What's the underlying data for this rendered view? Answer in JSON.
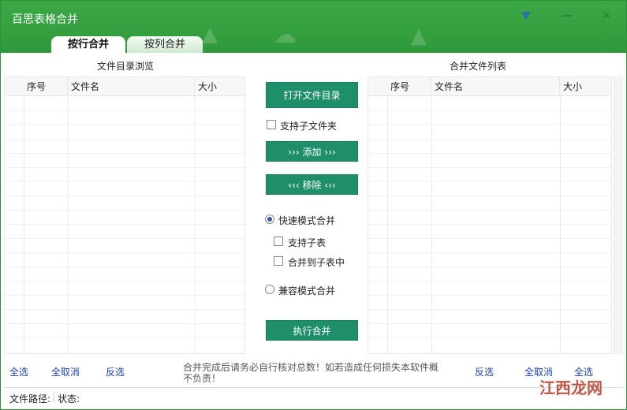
{
  "window": {
    "title": "百思表格合并"
  },
  "tabs": [
    {
      "label": "按行合并"
    },
    {
      "label": "按列合并"
    }
  ],
  "left_panel": {
    "title": "文件目录浏览",
    "columns": [
      "序号",
      "文件名",
      "大小"
    ]
  },
  "right_panel": {
    "title": "合并文件列表",
    "columns": [
      "序号",
      "文件名",
      "大小"
    ]
  },
  "center": {
    "open_dir": "打开文件目录",
    "include_sub": "支持子文件夹",
    "add": "››› 添加 ›››",
    "remove": "‹‹‹ 移除 ‹‹‹",
    "fast_mode": "快速模式合并",
    "support_sub_sheet": "支持子表",
    "merge_to_sub_sheet": "合并到子表中",
    "compat_mode": "兼容模式合并",
    "run": "执行合并"
  },
  "bottom": {
    "left_select_all": "全选",
    "left_cancel_all": "全取消",
    "left_invert": "反选",
    "notice": "合并完成后请务必自行核对总数！如若造成任何损失本软件概不负责！",
    "right_invert": "反选",
    "right_cancel_all": "全取消",
    "right_select_all": "全选"
  },
  "status": {
    "path_label": "文件路径:",
    "state_label": "状态:"
  },
  "watermark": "江西龙网"
}
